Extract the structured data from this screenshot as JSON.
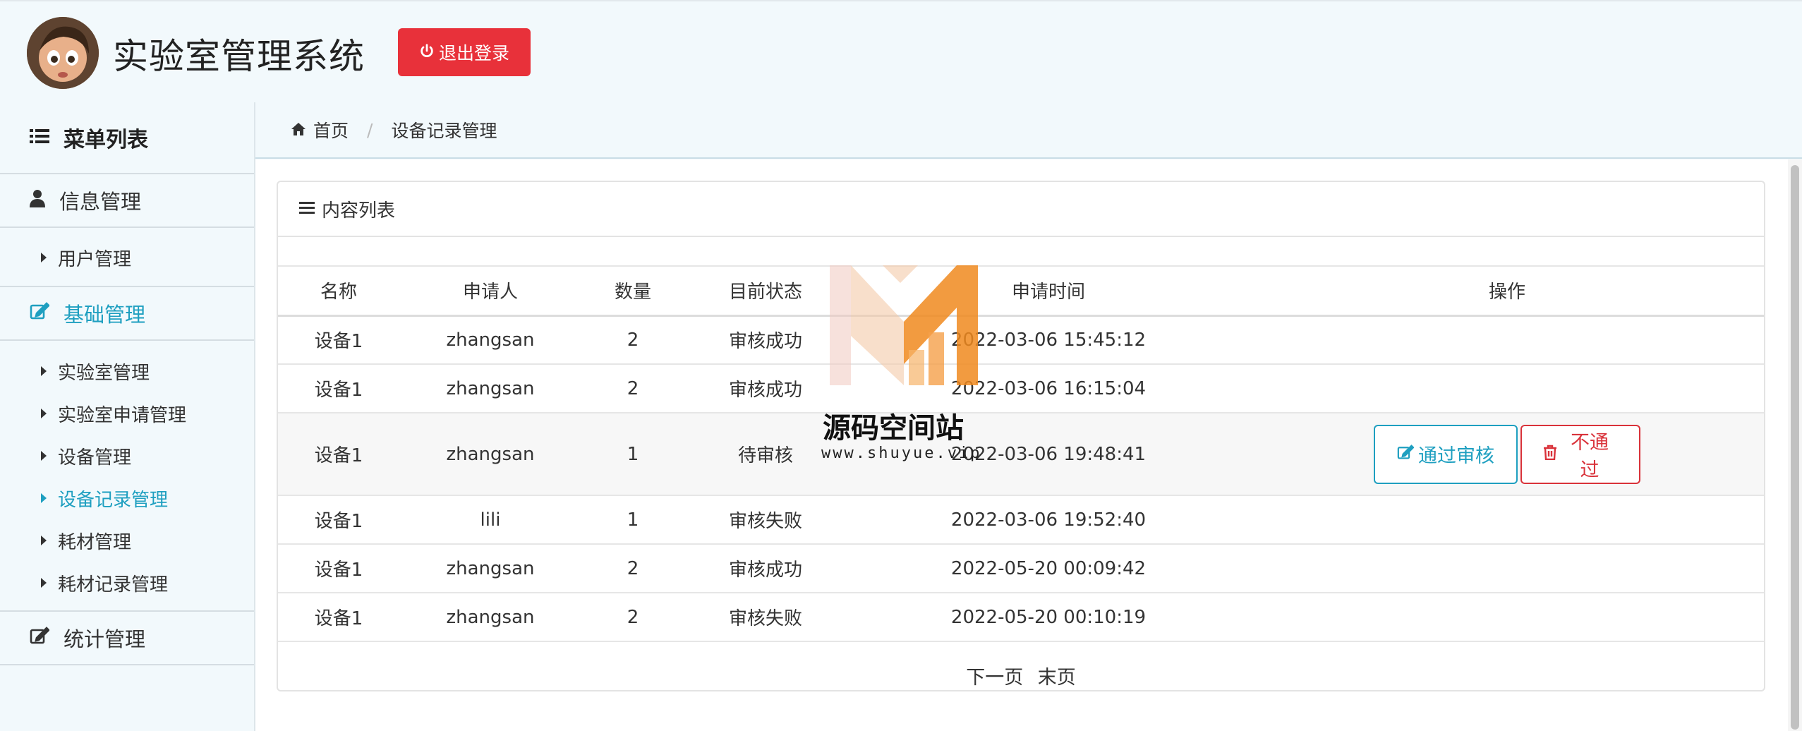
{
  "header": {
    "app_title": "实验室管理系统",
    "logout_label": "退出登录"
  },
  "sidebar": {
    "heading": "菜单列表",
    "groups": [
      {
        "label": "信息管理",
        "items": [
          {
            "label": "用户管理"
          }
        ]
      },
      {
        "label": "基础管理",
        "items": [
          {
            "label": "实验室管理"
          },
          {
            "label": "实验室申请管理"
          },
          {
            "label": "设备管理"
          },
          {
            "label": "设备记录管理"
          },
          {
            "label": "耗材管理"
          },
          {
            "label": "耗材记录管理"
          }
        ]
      },
      {
        "label": "统计管理",
        "items": []
      }
    ],
    "active_item": "设备记录管理",
    "active_group": "基础管理"
  },
  "breadcrumb": {
    "home": "首页",
    "current": "设备记录管理"
  },
  "panel": {
    "title": "内容列表",
    "columns": [
      "名称",
      "申请人",
      "数量",
      "目前状态",
      "申请时间",
      "操作"
    ],
    "rows": [
      {
        "name": "设备1",
        "applicant": "zhangsan",
        "qty": "2",
        "status": "审核成功",
        "time": "2022-03-06 15:45:12"
      },
      {
        "name": "设备1",
        "applicant": "zhangsan",
        "qty": "2",
        "status": "审核成功",
        "time": "2022-03-06 16:15:04"
      },
      {
        "name": "设备1",
        "applicant": "zhangsan",
        "qty": "1",
        "status": "待审核",
        "time": "2022-03-06 19:48:41"
      },
      {
        "name": "设备1",
        "applicant": "lili",
        "qty": "1",
        "status": "审核失败",
        "time": "2022-03-06 19:52:40"
      },
      {
        "name": "设备1",
        "applicant": "zhangsan",
        "qty": "2",
        "status": "审核成功",
        "time": "2022-05-20 00:09:42"
      },
      {
        "name": "设备1",
        "applicant": "zhangsan",
        "qty": "2",
        "status": "审核失败",
        "time": "2022-05-20 00:10:19"
      }
    ],
    "approve_label": "通过审核",
    "reject_label": "不通过"
  },
  "pager": {
    "next": "下一页",
    "last": "末页"
  },
  "watermark": {
    "name": "源码空间站",
    "url": "www.shuyue.vip"
  },
  "colors": {
    "accent": "#1e9fc0",
    "danger": "#e8313a",
    "background": "#f2f9fc"
  }
}
